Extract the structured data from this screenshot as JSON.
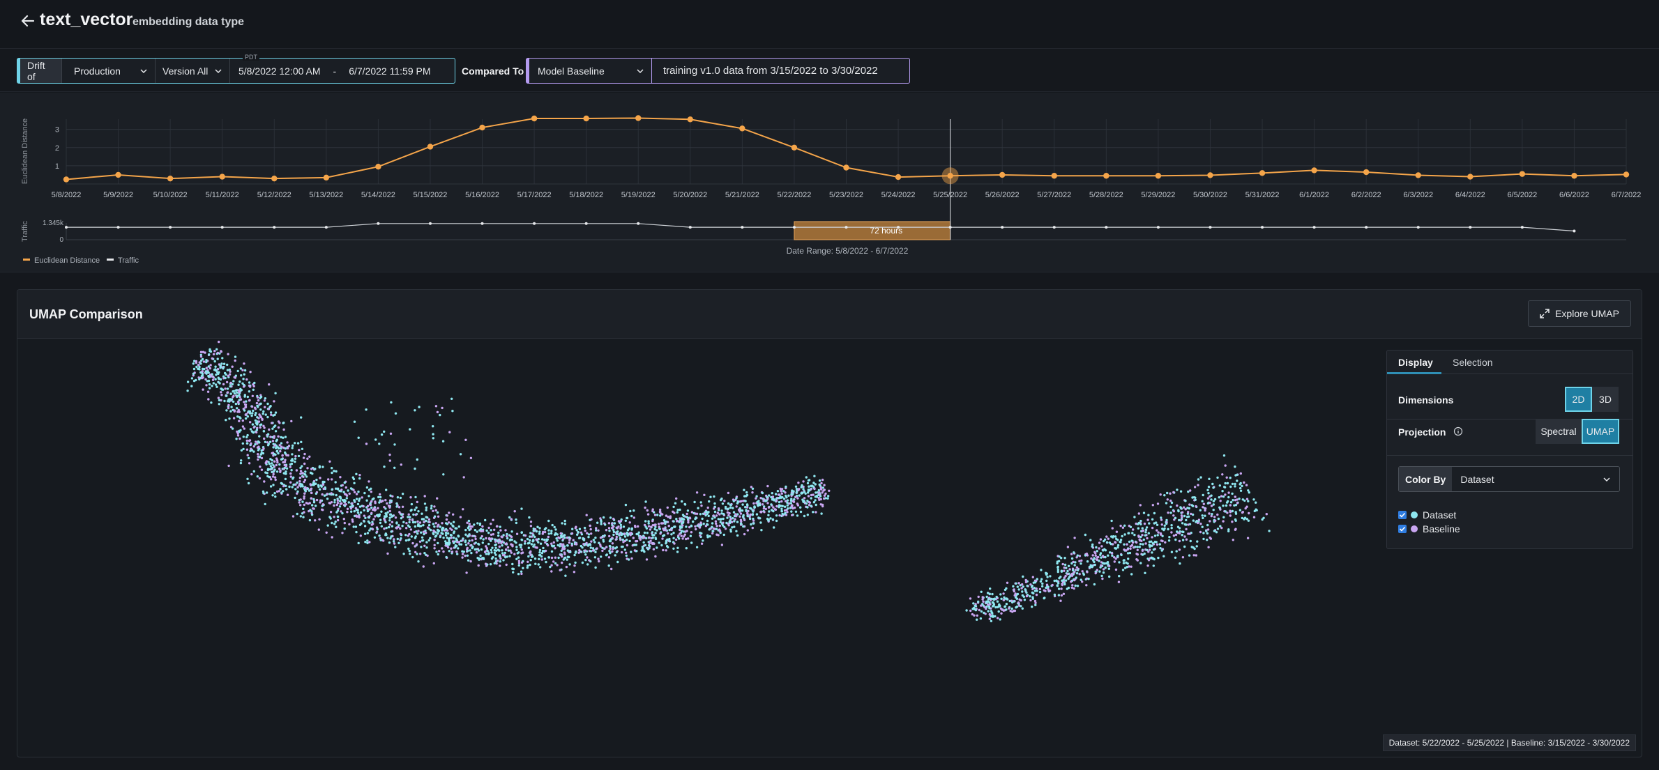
{
  "header": {
    "title": "text_vector",
    "subtitle": "embedding data type"
  },
  "filters": {
    "drift_label": "Drift of",
    "environment": "Production",
    "version": "Version All",
    "timezone": "PDT",
    "start": "5/8/2022 12:00 AM",
    "dash": "-",
    "end": "6/7/2022 11:59 PM",
    "compared_to_label": "Compared To",
    "baseline": "Model Baseline",
    "baseline_desc": "training v1.0 data from 3/15/2022 to 3/30/2022"
  },
  "chart_data": {
    "type": "line",
    "ylabel": "Euclidean Distance",
    "ylim": [
      0,
      3.6
    ],
    "yticks": [
      1,
      2,
      3
    ],
    "grid": true,
    "x": [
      "5/8/2022",
      "5/9/2022",
      "5/10/2022",
      "5/11/2022",
      "5/12/2022",
      "5/13/2022",
      "5/14/2022",
      "5/15/2022",
      "5/16/2022",
      "5/17/2022",
      "5/18/2022",
      "5/19/2022",
      "5/20/2022",
      "5/21/2022",
      "5/22/2022",
      "5/23/2022",
      "5/24/2022",
      "5/25/2022",
      "5/26/2022",
      "5/27/2022",
      "5/28/2022",
      "5/29/2022",
      "5/30/2022",
      "5/31/2022",
      "6/1/2022",
      "6/2/2022",
      "6/3/2022",
      "6/4/2022",
      "6/5/2022",
      "6/6/2022",
      "6/7/2022"
    ],
    "series": [
      {
        "name": "Euclidean Distance",
        "color": "#f5a54a",
        "values": [
          0.25,
          0.5,
          0.3,
          0.4,
          0.3,
          0.35,
          0.95,
          2.05,
          3.1,
          3.6,
          3.6,
          3.62,
          3.55,
          3.05,
          2.0,
          0.9,
          0.38,
          0.45,
          0.5,
          0.45,
          0.45,
          0.45,
          0.48,
          0.6,
          0.75,
          0.65,
          0.48,
          0.4,
          0.55,
          0.45,
          0.52
        ]
      }
    ],
    "traffic": {
      "name": "Traffic",
      "ylabel": "Traffic",
      "max_label": "1.345k",
      "zero_label": "0",
      "ylim": [
        0,
        1345
      ],
      "values": [
        1000,
        1000,
        1000,
        1000,
        1000,
        1000,
        1300,
        1300,
        1300,
        1300,
        1300,
        1300,
        1000,
        1000,
        1000,
        1000,
        1000,
        1000,
        1000,
        1000,
        1000,
        1000,
        1000,
        1000,
        1000,
        1000,
        1000,
        1000,
        1000,
        700
      ]
    },
    "selection": {
      "start_index": 14,
      "end_index": 17,
      "label": "72 hours"
    },
    "hover_index": 17,
    "legend": [
      "Euclidean Distance",
      "Traffic"
    ],
    "range_label": "Date Range: 5/8/2022 - 6/7/2022"
  },
  "umap": {
    "title": "UMAP Comparison",
    "explore_label": "Explore UMAP",
    "tabs": [
      "Display",
      "Selection"
    ],
    "dimensions_label": "Dimensions",
    "dim_options": [
      "2D",
      "3D"
    ],
    "projection_label": "Projection",
    "projection_options": [
      "Spectral",
      "UMAP"
    ],
    "color_by_label": "Color By",
    "color_by_value": "Dataset",
    "legend": [
      {
        "label": "Dataset",
        "color": "#8fe7f0"
      },
      {
        "label": "Baseline",
        "color": "#c9a6f2"
      }
    ],
    "footer": "Dataset: 5/22/2022 - 5/25/2022 | Baseline: 3/15/2022 - 3/30/2022"
  }
}
